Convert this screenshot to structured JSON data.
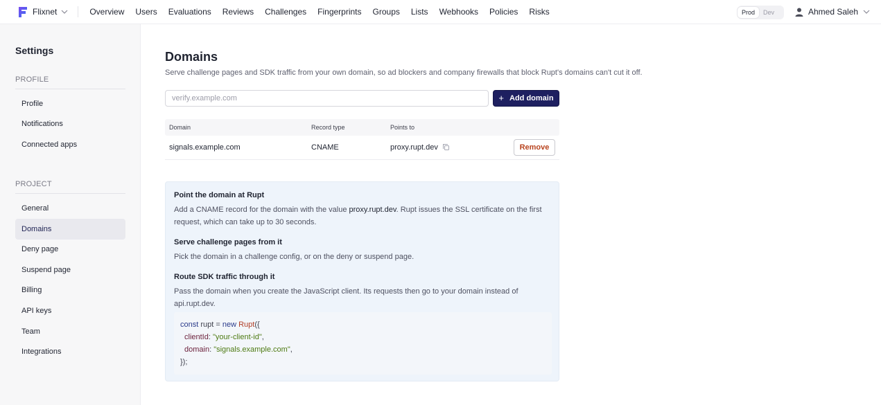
{
  "brand": {
    "name": "Flixnet"
  },
  "nav": [
    "Overview",
    "Users",
    "Evaluations",
    "Reviews",
    "Challenges",
    "Fingerprints",
    "Groups",
    "Lists",
    "Webhooks",
    "Policies",
    "Risks"
  ],
  "env": {
    "prod": "Prod",
    "dev": "Dev",
    "active": "Prod"
  },
  "user": {
    "name": "Ahmed Saleh"
  },
  "sidebar": {
    "title": "Settings",
    "profile_section": "PROFILE",
    "profile_items": [
      "Profile",
      "Notifications",
      "Connected apps"
    ],
    "project_section": "PROJECT",
    "project_items": [
      "General",
      "Domains",
      "Deny page",
      "Suspend page",
      "Billing",
      "API keys",
      "Team",
      "Integrations"
    ],
    "active": "Domains"
  },
  "main": {
    "title": "Domains",
    "subtitle": "Serve challenge pages and SDK traffic from your own domain, so ad blockers and company firewalls that block Rupt's domains can't cut it off.",
    "input_placeholder": "verify.example.com",
    "input_value": "",
    "add_button": "Add domain",
    "table": {
      "headers": [
        "Domain",
        "Record type",
        "Points to"
      ],
      "rows": [
        {
          "domain": "signals.example.com",
          "record_type": "CNAME",
          "points_to": "proxy.rupt.dev",
          "action": "Remove"
        }
      ]
    },
    "info": {
      "step1_title": "Point the domain at Rupt",
      "step1_text_a": "Add a CNAME record for the domain with the value ",
      "step1_text_strong": "proxy.rupt.dev",
      "step1_text_b": ". Rupt issues the SSL certificate on the first request, which can take up to 30 seconds.",
      "step2_title": "Serve challenge pages from it",
      "step2_text": "Pick the domain in a challenge config, or on the deny or suspend page.",
      "step3_title": "Route SDK traffic through it",
      "step3_text": "Pass the domain when you create the JavaScript client. Its requests then go to your domain instead of api.rupt.dev.",
      "code": {
        "kw_const": "const",
        "var": " rupt = ",
        "kw_new": "new",
        "cls": " Rupt",
        "open": "({",
        "key1": "clientId",
        "val1": "\"your-client-id\"",
        "key2": "domain",
        "val2": "\"signals.example.com\"",
        "close": "});"
      }
    }
  },
  "colors": {
    "primary_button": "#1e2060",
    "remove_text": "#b8441f",
    "info_bg": "#eef4fb",
    "sidebar_bg": "#f7f7f8"
  }
}
